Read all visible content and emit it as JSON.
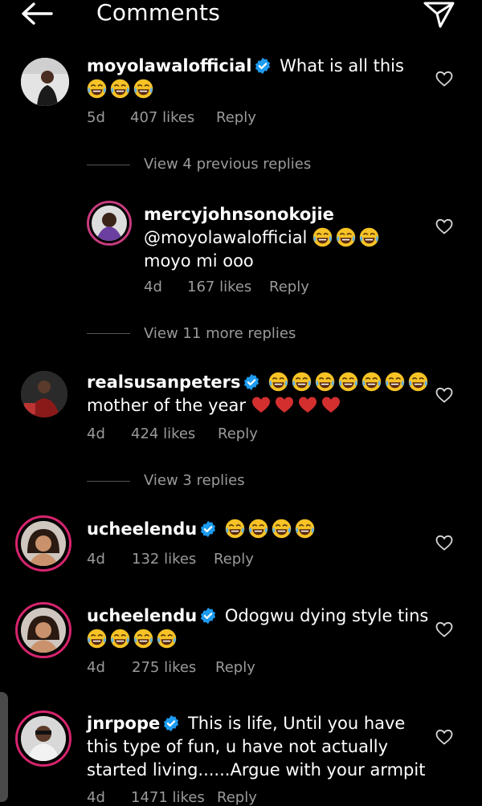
{
  "header": {
    "title": "Comments",
    "back_icon": "arrow-left-icon",
    "send_icon": "paper-plane-icon"
  },
  "colors": {
    "background": "#000000",
    "text": "#ffffff",
    "meta": "#9a9a9a",
    "verified": "#1d9bf0",
    "story_ring": "#d6246e",
    "heart_red": "#d32f2f"
  },
  "comments": [
    {
      "username": "moyolawalofficial",
      "verified": true,
      "text": "What is all this",
      "time": "5d",
      "likes": "407 likes",
      "reply": "Reply"
    },
    {
      "username": "mercyjohnsonokojie",
      "verified": false,
      "mention": "@moyolawalofficial",
      "text": "moyo mi ooo",
      "time": "4d",
      "likes": "167 likes",
      "reply": "Reply"
    },
    {
      "username": "realsusanpeters",
      "verified": true,
      "text": "mother of the year",
      "time": "4d",
      "likes": "424 likes",
      "reply": "Reply"
    },
    {
      "username": "ucheelendu",
      "verified": true,
      "text": "",
      "time": "4d",
      "likes": "132 likes",
      "reply": "Reply"
    },
    {
      "username": "ucheelendu",
      "verified": true,
      "text": "Odogwu dying style tins",
      "time": "4d",
      "likes": "275 likes",
      "reply": "Reply"
    },
    {
      "username": "jnrpope",
      "verified": true,
      "text_line1": "This is life, Until you have",
      "text_line2": "this type of fun, u have not actually",
      "text_line3": "started living......Argue with your armpit",
      "time": "4d",
      "likes": "1471 likes",
      "reply": "Reply"
    }
  ],
  "view_replies": [
    {
      "label": "View 4 previous replies"
    },
    {
      "label": "View 11 more replies"
    },
    {
      "label": "View 3 replies"
    }
  ],
  "emoji_icon": "tears-of-joy-emoji-icon"
}
